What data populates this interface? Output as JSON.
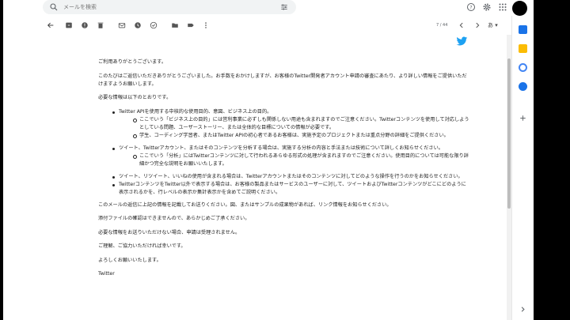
{
  "search": {
    "placeholder": "メールを検索"
  },
  "toolbar": {
    "counter": "7 / 44",
    "lang": "あ ▾"
  },
  "email": {
    "greeting": "ご利用ありがとうございます。",
    "p1": "このたびはご返信いただきありがとうございました。お手数をおかけしますが、お客様のTwitter開発者アカウント申請の審査にあたり、より詳しい情報をご提供いただけますようお願いします。",
    "p2": "必要な情報は以下のとおりです。",
    "items": [
      {
        "text": "Twitter APIを使用する中核的な使用目的、意図、ビジネス上の目的。",
        "sub": [
          "ここでいう「ビジネス上の目的」には営利事業に必ずしも関係しない用途も含まれますのでご注意ください。Twitterコンテンツを使用して対応しようとしている問題、ユーザーストーリー、または全体的な目標についての情報が必要です。",
          "学生、コーディング学習者、またはTwitter APIの初心者であるお客様は、実施予定のプロジェクトまたは重点分野の詳細をご提供ください。"
        ]
      },
      {
        "text": "ツイート、Twitterアカウント、またはそのコンテンツを分析する場合は、実施する分析の内容と手法または技術について詳しくお知らせください。",
        "sub": [
          "ここでいう「分析」にはTwitterコンテンツに対して行われるあらゆる形式の処理が含まれますのでご注意ください。使用目的については可能な限り詳細かつ完全な説明をお願いいたします。"
        ]
      },
      {
        "text": "ツイート、リツイート、いいねの使用が含まれる場合は、Twitterアカウントまたはそのコンテンツに対してどのような操作を行うのかをお知らせください。",
        "sub": []
      },
      {
        "text": "TwitterコンテンツをTwitter以外で表示する場合は、お客様の製品またはサービスのユーザーに対して、ツイートおよびTwitterコンテンツがどこにどのように表示されるかを、行レベルの表示か集計表示かを含めてご説明ください。",
        "sub": []
      }
    ],
    "p3": "このメールの返信に上記の情報を記載してお送りください。図、またはサンプルの成果物があれば、リンク情報をお知らせください。",
    "p4": "添付ファイルの確認はできませんので、あらかじめご了承ください。",
    "p5": "必要な情報をお送りいただけない場合、申請は受理されません。",
    "p6": "ご理解、ご協力いただければ幸いです。",
    "p7": "よろしくお願いいたします。",
    "signature": "Twitter"
  },
  "colors": {
    "twitter_blue": "#1da1f2",
    "keep_yellow": "#fbbc04",
    "tasks_blue": "#4285f4",
    "calendar_blue": "#1a73e8"
  }
}
